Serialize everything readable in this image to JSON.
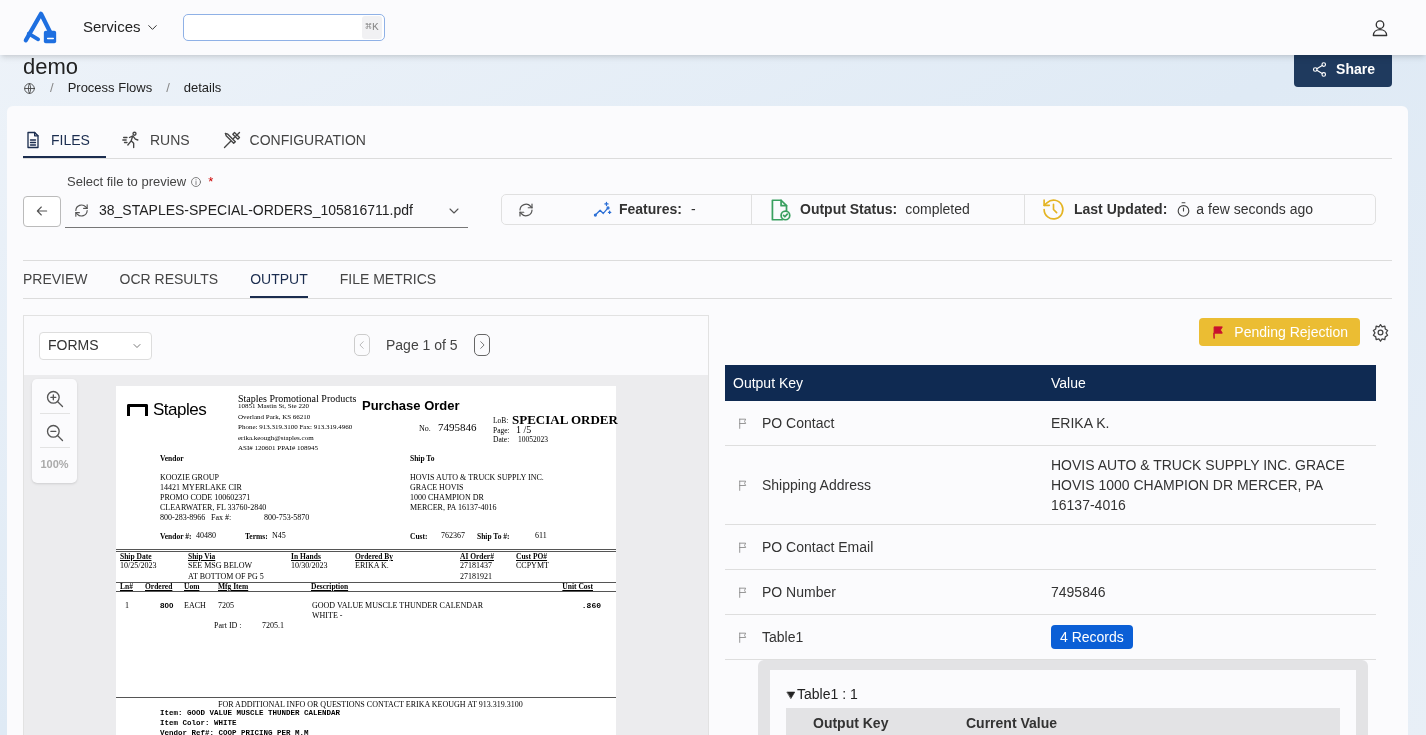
{
  "header": {
    "menu": "Services",
    "search": {
      "shortcut": "⌘K"
    }
  },
  "page": {
    "title": "demo",
    "breadcrumb": [
      {
        "separator": "/",
        "label": "Process Flows"
      },
      {
        "separator": "/",
        "label": "details"
      }
    ],
    "share": "Share"
  },
  "tabs": [
    {
      "label": "FILES",
      "selected": true,
      "kind": "file"
    },
    {
      "label": "RUNS",
      "selected": false,
      "kind": "runs"
    },
    {
      "label": "CONFIGURATION",
      "selected": false,
      "kind": "tools"
    }
  ],
  "file_select": {
    "label": "Select file to preview",
    "required": "*",
    "value": "38_STAPLES-SPECIAL-ORDERS_105816711.pdf"
  },
  "status": {
    "features": {
      "label": "Features:",
      "value": "-"
    },
    "output_status": {
      "label": "Output Status:",
      "value": "completed"
    },
    "last_updated": {
      "label": "Last Updated:",
      "value": "a few seconds ago"
    }
  },
  "sub_tabs": [
    {
      "label": "PREVIEW",
      "selected": false
    },
    {
      "label": "OCR RESULTS",
      "selected": false
    },
    {
      "label": "OUTPUT",
      "selected": true
    },
    {
      "label": "FILE METRICS",
      "selected": false
    }
  ],
  "viewer": {
    "mode": "FORMS",
    "pager": "Page 1 of 5",
    "zoom": "100%"
  },
  "document": {
    "logo": "Staples",
    "company": [
      "Staples Promotional Products",
      "10851 Mastin St, Ste 220",
      "Overland Park, KS 66210",
      "Phone: 913.319.3100  Fax: 913.319.4960",
      "erika.keough@staples.com",
      "ASI# 120601   PPAI# 108945"
    ],
    "title": "Purchase Order",
    "number_label": "No.",
    "number": "7495846",
    "meta": [
      {
        "label": "LoB:",
        "value": "SPECIAL ORDER"
      },
      {
        "label": "Page:",
        "value": "1 /5"
      },
      {
        "label": "Date:",
        "value": "10052023"
      }
    ],
    "vendor_label": "Vendor",
    "vendor_lines": [
      "KOOZIE GROUP",
      "14421 MYERLAKE CIR",
      "PROMO CODE 100602371",
      "CLEARWATER, FL  33760-2840"
    ],
    "vendor_phone": {
      "phone": "800-283-8966",
      "fax_label": "Fax #:",
      "fax": "800-753-5870"
    },
    "ship_to_label": "Ship To",
    "ship_to_lines": [
      "HOVIS AUTO & TRUCK SUPPLY INC.",
      "GRACE HOVIS",
      "1000 CHAMPION DR",
      "MERCER, PA  16137-4016"
    ],
    "references": [
      {
        "label": "Vendor #:",
        "value": "40480"
      },
      {
        "label": "Terms:",
        "value": "N45"
      },
      {
        "label": "Cust:",
        "value": "762367"
      },
      {
        "label": "Ship To #:",
        "value": "611"
      }
    ],
    "shipping": {
      "columns": [
        "Ship Date",
        "Ship Via",
        "In Hands",
        "Ordered By",
        "AI Order#",
        "Cust PO#"
      ],
      "cells": [
        [
          "10/25/2023"
        ],
        [
          "SEE MSG BELOW",
          "AT BOTTOM OF PG 5"
        ],
        [
          "10/30/2023"
        ],
        [
          "ERIKA K."
        ],
        [
          "27181437",
          "27181921"
        ],
        [
          "CCPYMT"
        ]
      ]
    },
    "lines": {
      "columns": [
        "Ln#",
        "Ordered",
        "Uom",
        "Mfg Item",
        "Description",
        "Unit Cost"
      ],
      "cells": [
        [
          "1"
        ],
        [
          "800"
        ],
        [
          "EACH"
        ],
        [
          "7205"
        ],
        [
          "GOOD VALUE MUSCLE THUNDER CALENDAR",
          "WHITE -"
        ],
        [
          ".860"
        ]
      ]
    },
    "part_id": {
      "label": "Part ID :",
      "value": "7205.1"
    },
    "footer_note": "FOR ADDITIONAL INFO OR QUESTIONS CONTACT ERIKA KEOUGH AT 913.319.3100",
    "notes": [
      "Item: GOOD VALUE MUSCLE THUNDER CALENDAR",
      "Item Color: WHITE",
      "Vendor Ref#: COOP PRICING PER M.M"
    ]
  },
  "review": {
    "status": "Pending Rejection"
  },
  "output_table": {
    "columns": [
      "Output Key",
      "Value"
    ],
    "rows": [
      {
        "key": "PO Contact",
        "kind": "text",
        "value": "ERIKA K."
      },
      {
        "key": "Shipping Address",
        "kind": "text",
        "value": "HOVIS AUTO & TRUCK SUPPLY INC. GRACE HOVIS 1000 CHAMPION DR MERCER, PA 16137-4016"
      },
      {
        "key": "PO Contact Email",
        "kind": "text"
      },
      {
        "key": "PO Number",
        "kind": "text",
        "value": "7495846"
      },
      {
        "key": "Table1",
        "kind": "records",
        "value": "4 Records",
        "records": [
          {
            "title": "Table1 : 1",
            "expanded": true,
            "columns": [
              "Output Key",
              "Current Value"
            ]
          }
        ]
      }
    ]
  }
}
